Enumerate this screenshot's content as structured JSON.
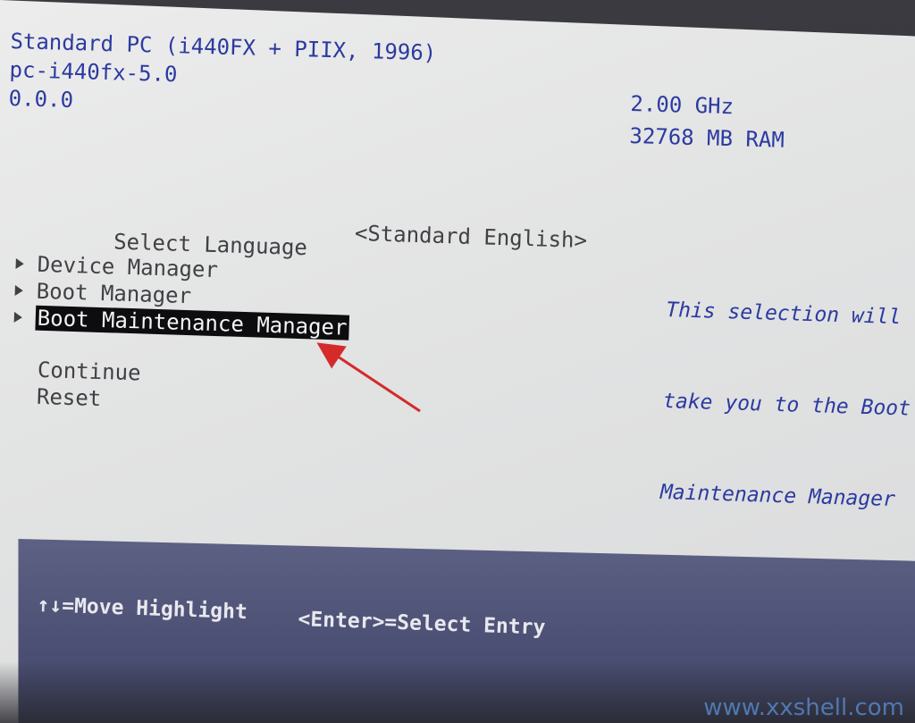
{
  "header": {
    "machine": "Standard PC (i440FX + PIIX, 1996)",
    "model": "pc-i440fx-5.0",
    "version": "0.0.0"
  },
  "sysinfo": {
    "cpu_speed": "2.00 GHz",
    "memory": "32768 MB RAM"
  },
  "menu": {
    "language_label": "Select Language",
    "language_value": "<Standard English>",
    "items": [
      {
        "label": "Device Manager"
      },
      {
        "label": "Boot Manager"
      },
      {
        "label": "Boot Maintenance Manager",
        "selected": true
      }
    ],
    "continue_label": "Continue",
    "reset_label": "Reset"
  },
  "help_text": {
    "line1": "This selection will",
    "line2": "take you to the Boot",
    "line3": "Maintenance Manager"
  },
  "footer": {
    "move_hint": "↑↓=Move Highlight",
    "enter_hint": "<Enter>=Select Entry"
  },
  "colors": {
    "header_text": "#2b3aa0",
    "highlight_bg": "#0d0d10",
    "footer_bg": "#4b4f73",
    "annotation_arrow": "#d42a2a"
  },
  "watermark": "www.xxshell.com"
}
